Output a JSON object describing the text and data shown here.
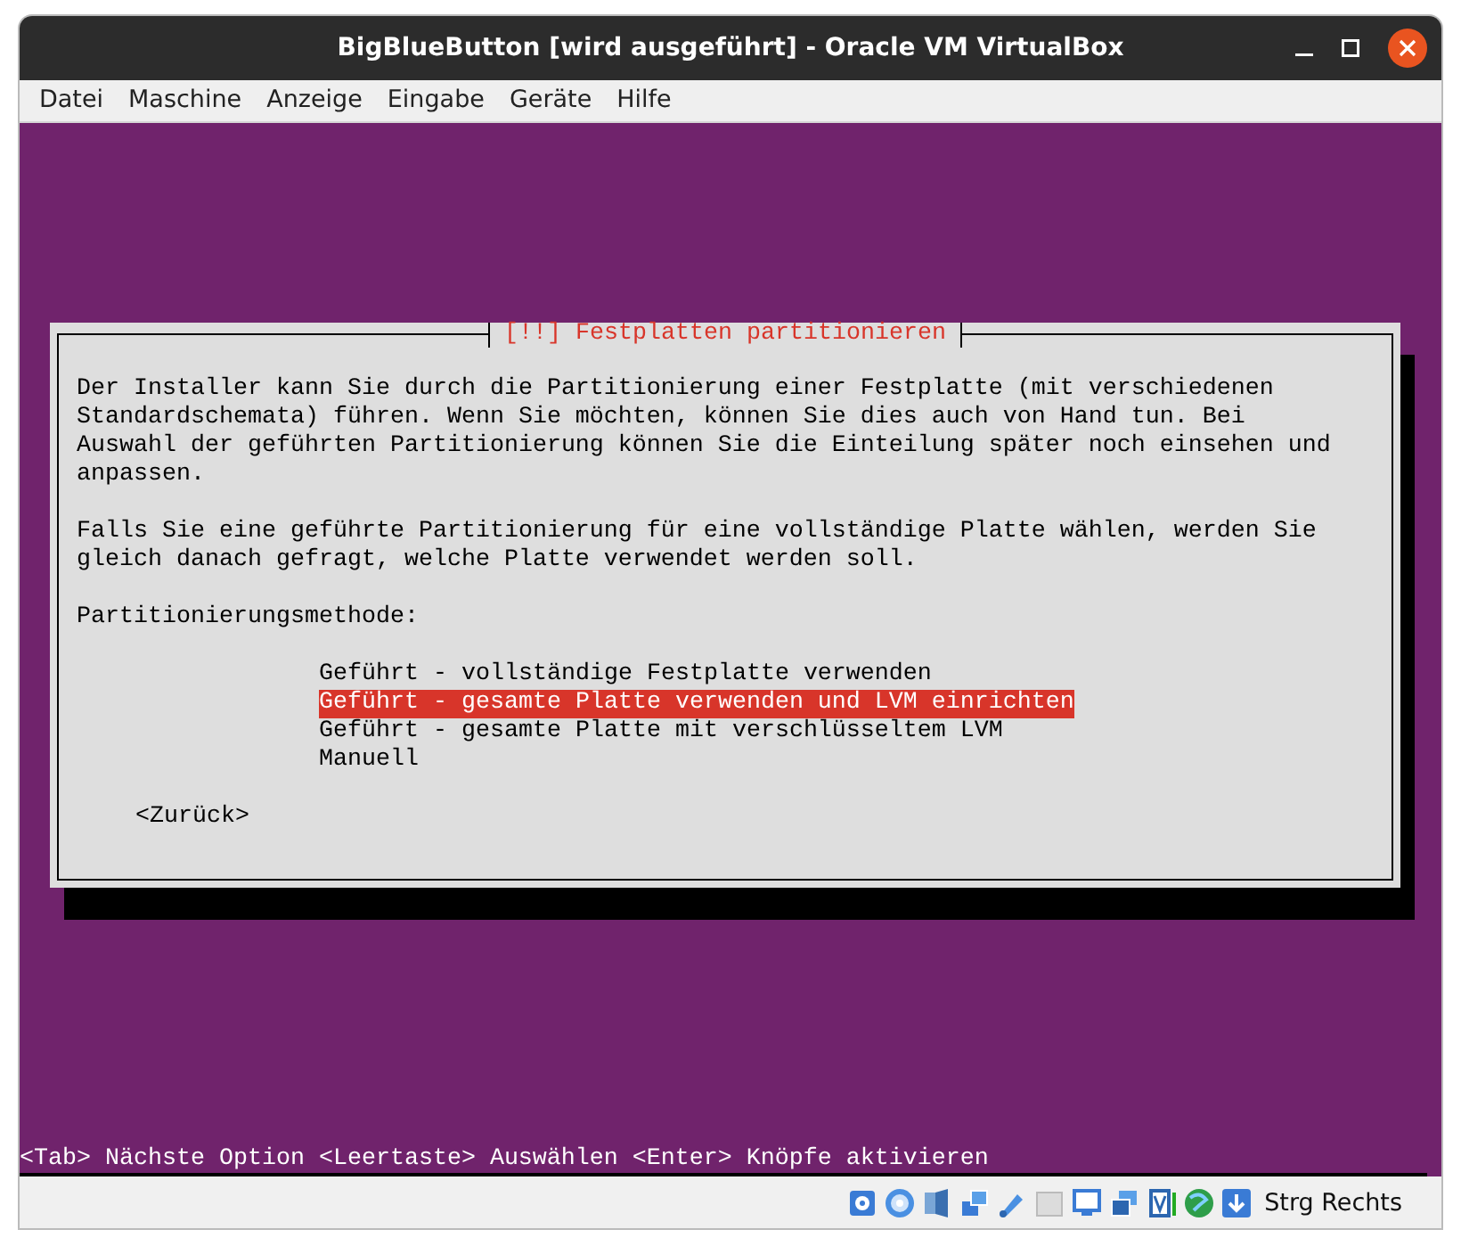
{
  "window": {
    "title": "BigBlueButton [wird ausgeführt] - Oracle VM VirtualBox"
  },
  "menu": [
    "Datei",
    "Maschine",
    "Anzeige",
    "Eingabe",
    "Geräte",
    "Hilfe"
  ],
  "dialog": {
    "title": "[!!] Festplatten partitionieren",
    "paragraphs": [
      [
        "Der Installer kann Sie durch die Partitionierung einer Festplatte (mit verschiedenen",
        "Standardschemata) führen. Wenn Sie möchten, können Sie dies auch von Hand tun. Bei",
        "Auswahl der geführten Partitionierung können Sie die Einteilung später noch einsehen und",
        "anpassen."
      ],
      [
        "Falls Sie eine geführte Partitionierung für eine vollständige Platte wählen, werden Sie",
        "gleich danach gefragt, welche Platte verwendet werden soll."
      ],
      [
        "Partitionierungsmethode:"
      ]
    ],
    "options": [
      {
        "label": "Geführt - vollständige Festplatte verwenden",
        "selected": false
      },
      {
        "label": "Geführt - gesamte Platte verwenden und LVM einrichten",
        "selected": true
      },
      {
        "label": "Geführt - gesamte Platte mit verschlüsseltem LVM",
        "selected": false
      },
      {
        "label": "Manuell",
        "selected": false
      }
    ],
    "back_button": "<Zurück>"
  },
  "hint_line": "<Tab> Nächste Option <Leertaste> Auswählen <Enter> Knöpfe aktivieren",
  "status_bar": {
    "host_key": "Strg Rechts"
  }
}
